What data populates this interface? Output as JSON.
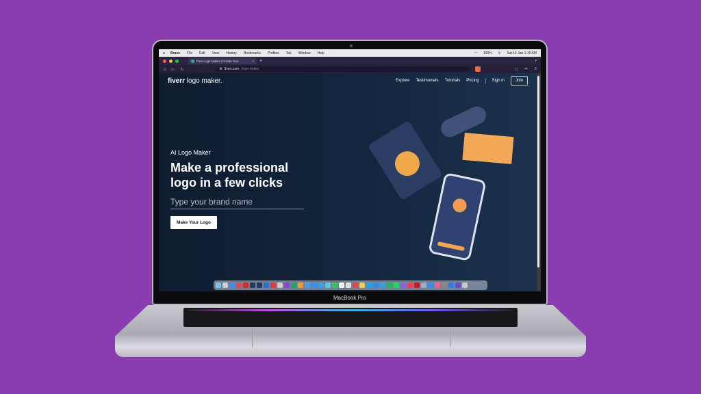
{
  "device": {
    "model_label": "MacBook Pro"
  },
  "menubar": {
    "items": [
      "Brave",
      "File",
      "Edit",
      "View",
      "History",
      "Bookmarks",
      "Profiles",
      "Tab",
      "Window",
      "Help"
    ],
    "battery": "100%",
    "clock": "Sat 15 Jan  1:10 AM"
  },
  "browser": {
    "tab_title": "Free Logo Maker | Create Your",
    "tab_close": "×",
    "new_tab": "+",
    "url_host": "fiverr.com",
    "url_path": "/logo-maker"
  },
  "site": {
    "logo_bold": "fiverr",
    "logo_rest": " logo maker.",
    "nav": [
      "Explore",
      "Testimonials",
      "Tutorials",
      "Pricing"
    ],
    "sign_in": "Sign in",
    "join": "Join",
    "eyebrow": "AI Logo Maker",
    "headline": "Make a professional logo in a few clicks",
    "input_placeholder": "Type your brand name",
    "cta": "Make Your Logo"
  },
  "dock_colors": [
    "#7bc3f0",
    "#d0d0d8",
    "#3d8ef0",
    "#e04a4a",
    "#d22c2c",
    "#1f3a66",
    "#1f3a66",
    "#2b6fd6",
    "#e03a3a",
    "#cccccc",
    "#8e44d8",
    "#21a366",
    "#f39c34",
    "#3aa0f0",
    "#3a8cf0",
    "#39a0f0",
    "#5ac8e0",
    "#34c759",
    "#f0f0f0",
    "#e0e0e0",
    "#e04a4a",
    "#f0d060",
    "#1da1f2",
    "#2a8cf0",
    "#2aa0e0",
    "#1db954",
    "#25d366",
    "#8e5cf0",
    "#fc3c44",
    "#c0192c",
    "#9ab0c8",
    "#3a8cf0",
    "#f06090",
    "#888888",
    "#2a7cf0",
    "#6a4cc0",
    "#c8c8cc"
  ]
}
